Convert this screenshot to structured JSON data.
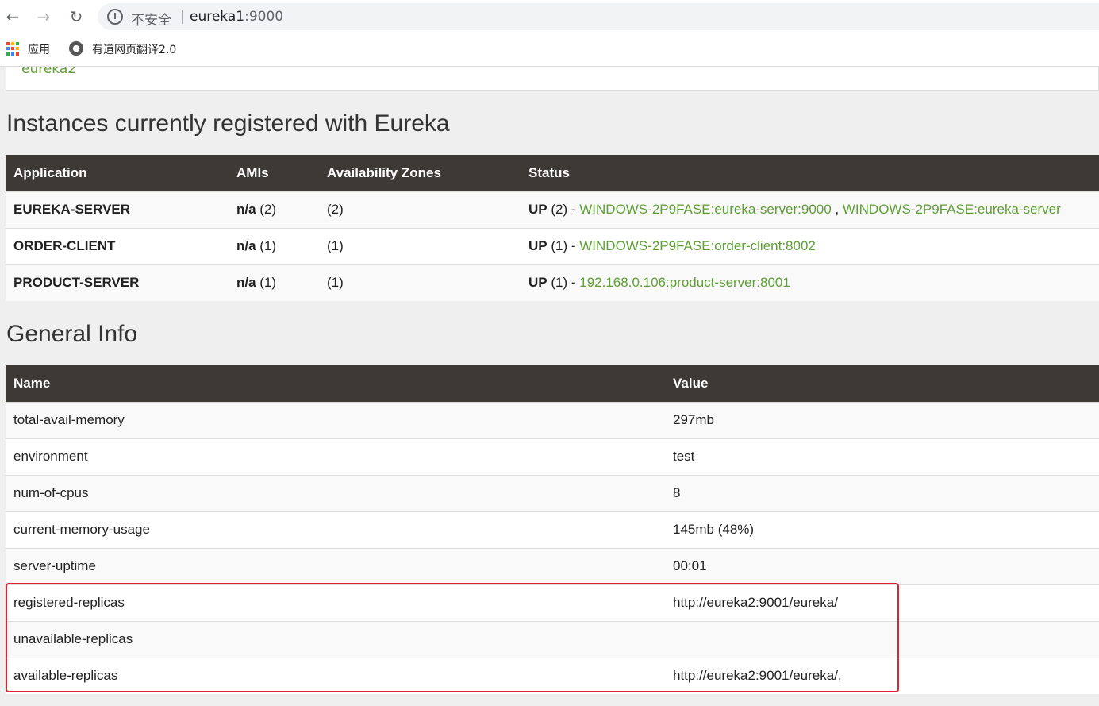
{
  "browser": {
    "insecure_label": "不安全",
    "separator": "|",
    "url_host": "eureka1",
    "url_port": ":9000",
    "bookmarks": {
      "apps_label": "应用",
      "youdao_label": "有道网页翻译2.0"
    }
  },
  "replica_link": "eureka2",
  "instances": {
    "heading": "Instances currently registered with Eureka",
    "headers": [
      "Application",
      "AMIs",
      "Availability Zones",
      "Status"
    ],
    "rows": [
      {
        "application": "EUREKA-SERVER",
        "amis_label": "n/a",
        "amis_count": "(2)",
        "zones": "(2)",
        "status_label": "UP",
        "status_count": "(2) -",
        "links": [
          "WINDOWS-2P9FASE:eureka-server:9000",
          "WINDOWS-2P9FASE:eureka-server"
        ],
        "link_sep": " , "
      },
      {
        "application": "ORDER-CLIENT",
        "amis_label": "n/a",
        "amis_count": "(1)",
        "zones": "(1)",
        "status_label": "UP",
        "status_count": "(1) -",
        "links": [
          "WINDOWS-2P9FASE:order-client:8002"
        ]
      },
      {
        "application": "PRODUCT-SERVER",
        "amis_label": "n/a",
        "amis_count": "(1)",
        "zones": "(1)",
        "status_label": "UP",
        "status_count": "(1) -",
        "links": [
          "192.168.0.106:product-server:8001"
        ]
      }
    ]
  },
  "general": {
    "heading": "General Info",
    "headers": [
      "Name",
      "Value"
    ],
    "rows": [
      {
        "name": "total-avail-memory",
        "value": "297mb"
      },
      {
        "name": "environment",
        "value": "test"
      },
      {
        "name": "num-of-cpus",
        "value": "8"
      },
      {
        "name": "current-memory-usage",
        "value": "145mb (48%)"
      },
      {
        "name": "server-uptime",
        "value": "00:01"
      },
      {
        "name": "registered-replicas",
        "value": "http://eureka2:9001/eureka/"
      },
      {
        "name": "unavailable-replicas",
        "value": ""
      },
      {
        "name": "available-replicas",
        "value": "http://eureka2:9001/eureka/,"
      }
    ]
  },
  "colors": {
    "link_green": "#5ea034",
    "header_dark": "#3d3935",
    "highlight_red": "#e0242b"
  }
}
